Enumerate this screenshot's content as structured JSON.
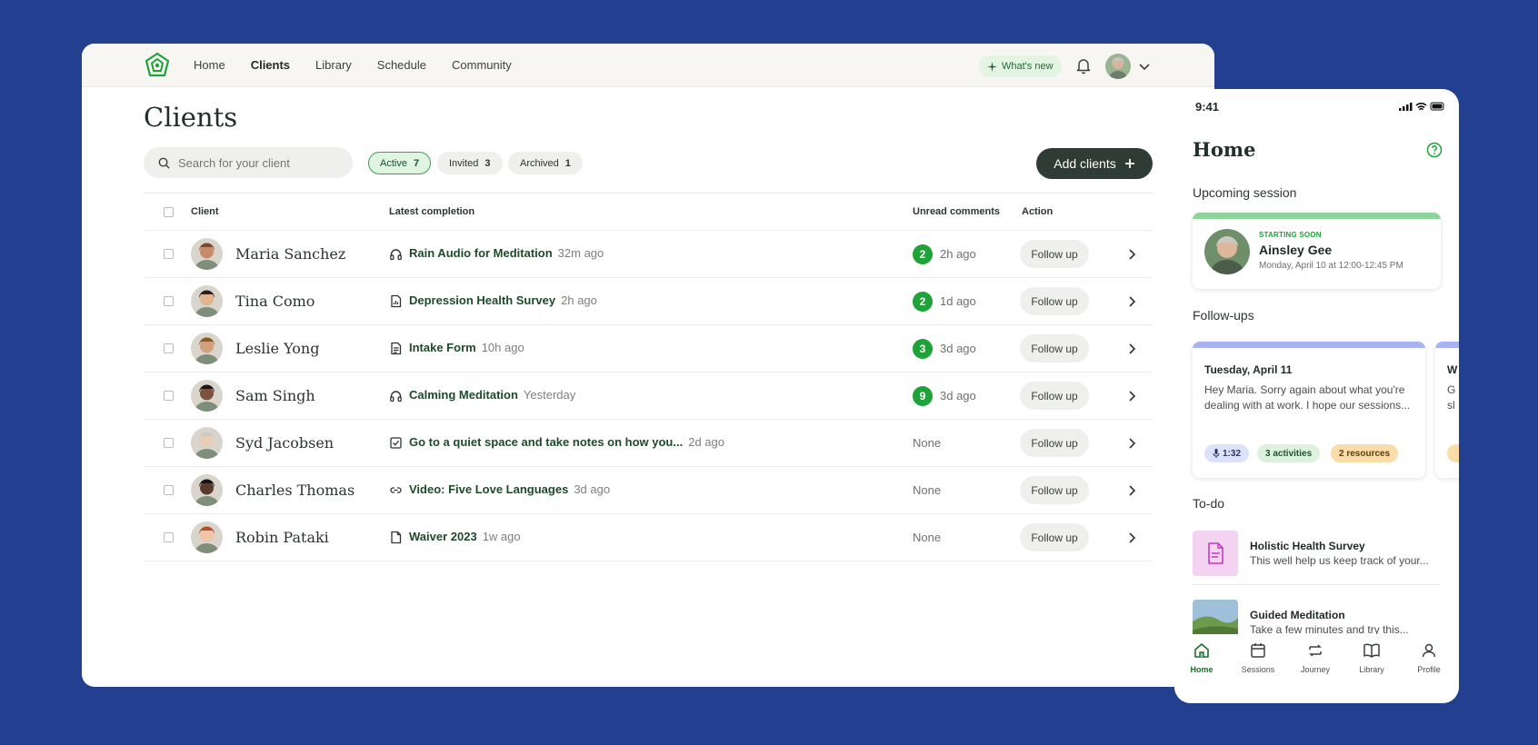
{
  "nav": {
    "links": [
      "Home",
      "Clients",
      "Library",
      "Schedule",
      "Community"
    ],
    "active": "Clients",
    "whats_new": "What's new"
  },
  "page": {
    "title": "Clients",
    "search_placeholder": "Search for your client",
    "filters": [
      {
        "label": "Active",
        "count": "7"
      },
      {
        "label": "Invited",
        "count": "3"
      },
      {
        "label": "Archived",
        "count": "1"
      }
    ],
    "add_button": "Add clients"
  },
  "table": {
    "headers": {
      "client": "Client",
      "latest": "Latest completion",
      "unread": "Unread comments",
      "action": "Action"
    },
    "rows": [
      {
        "name": "Maria Sanchez",
        "icon": "headphones-icon",
        "activity": "Rain Audio for Meditation",
        "ago": "32m ago",
        "unread": "2",
        "unread_time": "2h ago",
        "action": "Follow up"
      },
      {
        "name": "Tina Como",
        "icon": "survey-icon",
        "activity": "Depression Health Survey",
        "ago": "2h ago",
        "unread": "2",
        "unread_time": "1d ago",
        "action": "Follow up"
      },
      {
        "name": "Leslie Yong",
        "icon": "form-icon",
        "activity": "Intake Form",
        "ago": "10h ago",
        "unread": "3",
        "unread_time": "3d ago",
        "action": "Follow up"
      },
      {
        "name": "Sam Singh",
        "icon": "headphones-icon",
        "activity": "Calming Meditation",
        "ago": "Yesterday",
        "unread": "9",
        "unread_time": "3d ago",
        "action": "Follow up"
      },
      {
        "name": "Syd Jacobsen",
        "icon": "checkbox-icon",
        "activity": "Go to a quiet space and take notes on how you...",
        "ago": "2d ago",
        "unread": "",
        "unread_time": "None",
        "action": "Follow up"
      },
      {
        "name": "Charles Thomas",
        "icon": "link-icon",
        "activity": "Video: Five Love Languages",
        "ago": "3d ago",
        "unread": "",
        "unread_time": "None",
        "action": "Follow up"
      },
      {
        "name": "Robin Pataki",
        "icon": "file-icon",
        "activity": "Waiver 2023",
        "ago": "1w ago",
        "unread": "",
        "unread_time": "None",
        "action": "Follow up"
      }
    ]
  },
  "mobile": {
    "time": "9:41",
    "title": "Home",
    "upcoming_heading": "Upcoming session",
    "session": {
      "tag": "STARTING SOON",
      "name": "Ainsley Gee",
      "date": "Monday, April 10 at 12:00-12:45 PM"
    },
    "followups_heading": "Follow-ups",
    "followup": {
      "date": "Tuesday, April 11",
      "text": "Hey Maria. Sorry again about what you're dealing with at work. I hope our sessions...",
      "chips": [
        "1:32",
        "3 activities",
        "2 resources"
      ]
    },
    "followup_peek": {
      "date": "W",
      "text1": "G",
      "text2": "sl"
    },
    "todo_heading": "To-do",
    "todos": [
      {
        "title": "Holistic Health Survey",
        "desc": "This well help us keep track of your..."
      },
      {
        "title": "Guided Meditation",
        "desc": "Take a few minutes and try this..."
      }
    ],
    "tabs": [
      "Home",
      "Sessions",
      "Journey",
      "Library",
      "Profile"
    ]
  }
}
